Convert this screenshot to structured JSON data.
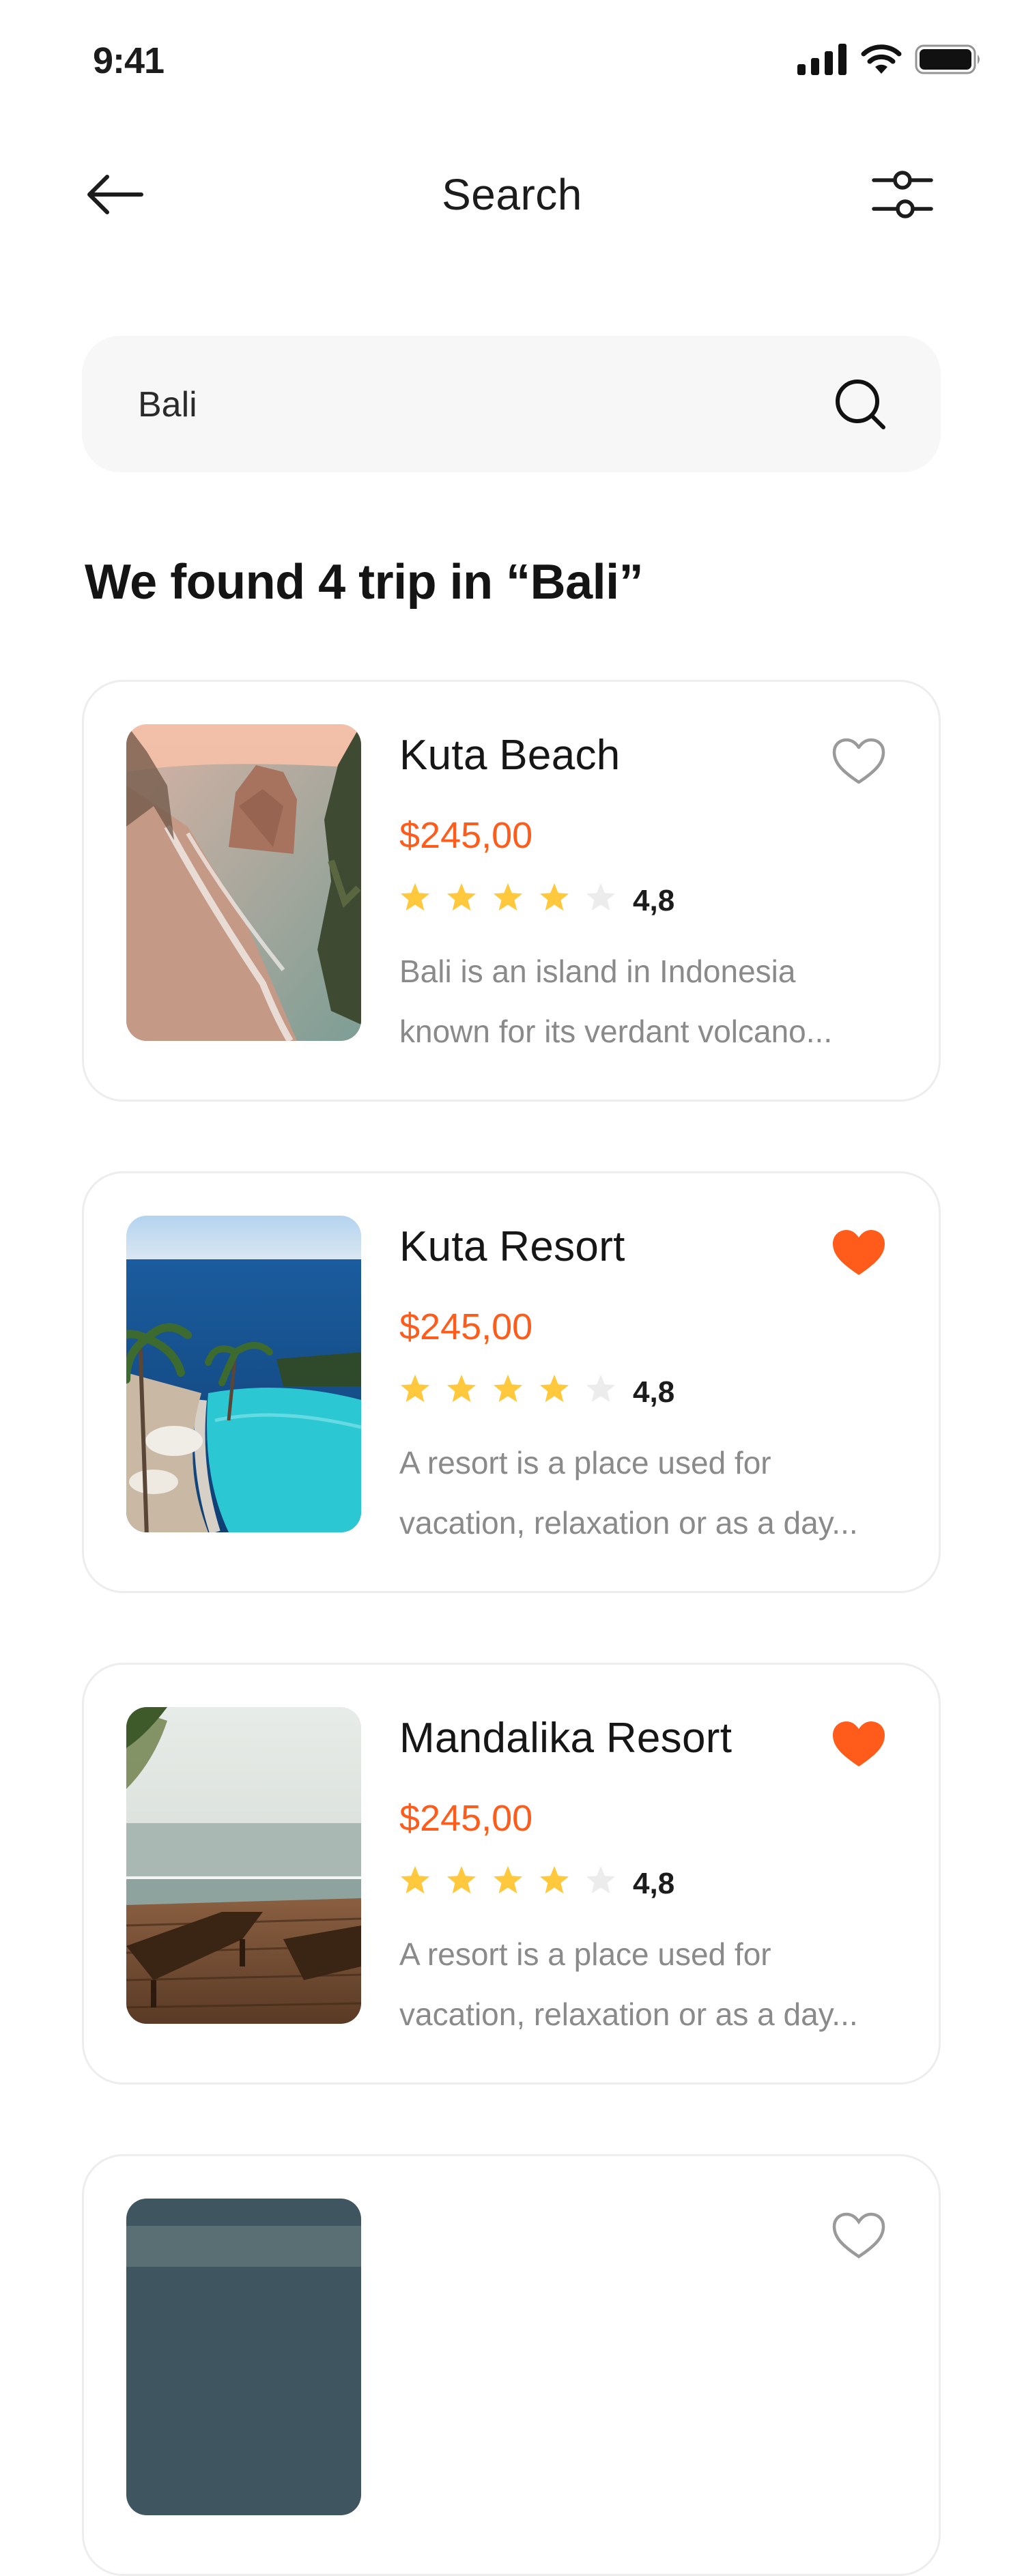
{
  "status_bar": {
    "time": "9:41",
    "icons": [
      "signal-icon",
      "wifi-icon",
      "battery-icon"
    ]
  },
  "header": {
    "title": "Search",
    "back_icon": "arrow-left-icon",
    "filter_icon": "filter-sliders-icon"
  },
  "search": {
    "value": "Bali",
    "icon": "search-icon"
  },
  "results": {
    "heading": "We found 4 trip in “Bali”",
    "items": [
      {
        "name": "Kuta Beach",
        "price": "$245,00",
        "stars": 4,
        "max_stars": 5,
        "rating": "4,8",
        "description_line1": "Bali is an island in Indonesia",
        "description_line2": "known for its verdant volcano...",
        "favorite": false,
        "photo": "beach-rock-photo"
      },
      {
        "name": "Kuta Resort",
        "price": "$245,00",
        "stars": 4,
        "max_stars": 5,
        "rating": "4,8",
        "description_line1": "A resort is a place used for",
        "description_line2": "vacation, relaxation or as a day...",
        "favorite": true,
        "photo": "resort-pool-photo"
      },
      {
        "name": "Mandalika Resort",
        "price": "$245,00",
        "stars": 4,
        "max_stars": 5,
        "rating": "4,8",
        "description_line1": "A resort is a place used for",
        "description_line2": "vacation, relaxation or as a day...",
        "favorite": true,
        "photo": "sea-deck-photo"
      }
    ]
  },
  "colors": {
    "accent": "#ff5c1b",
    "star": "#ffc83d",
    "star_empty": "#ececec",
    "muted_text": "#8a8a8a",
    "card_border": "#ededed",
    "search_bg": "#f7f7f7"
  }
}
